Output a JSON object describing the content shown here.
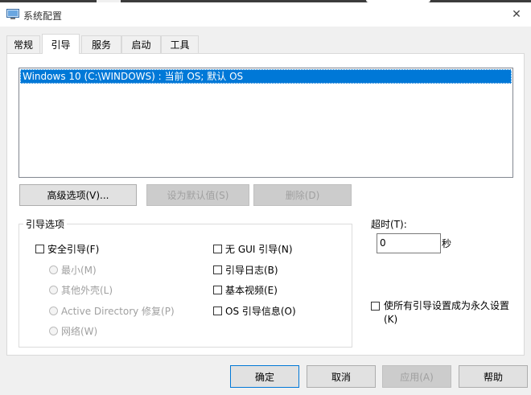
{
  "window": {
    "title": "系统配置",
    "close_glyph": "✕"
  },
  "tabs": [
    {
      "label": "常规"
    },
    {
      "label": "引导",
      "active": true
    },
    {
      "label": "服务"
    },
    {
      "label": "启动"
    },
    {
      "label": "工具"
    }
  ],
  "boot": {
    "os_entries": [
      "Windows 10 (C:\\WINDOWS) : 当前 OS; 默认 OS"
    ],
    "advanced_button": "高级选项(V)...",
    "set_default_button": "设为默认值(S)",
    "delete_button": "删除(D)"
  },
  "boot_options": {
    "group_label": "引导选项",
    "safe_boot": "安全引导(F)",
    "safe_modes": [
      "最小(M)",
      "其他外壳(L)",
      "Active Directory 修复(P)",
      "网络(W)"
    ],
    "no_gui": "无 GUI 引导(N)",
    "boot_log": "引导日志(B)",
    "base_video": "基本视频(E)",
    "os_boot_info": "OS 引导信息(O)"
  },
  "timeout": {
    "label": "超时(T):",
    "value": "0",
    "unit": "秒"
  },
  "permanent": {
    "label": "使所有引导设置成为永久设置(K)"
  },
  "footer": {
    "ok": "确定",
    "cancel": "取消",
    "apply": "应用(A)",
    "help": "帮助"
  },
  "colors": {
    "selection": "#0078d7",
    "window_bg": "#f0f0f0",
    "disabled_text": "#a0a0a0"
  }
}
